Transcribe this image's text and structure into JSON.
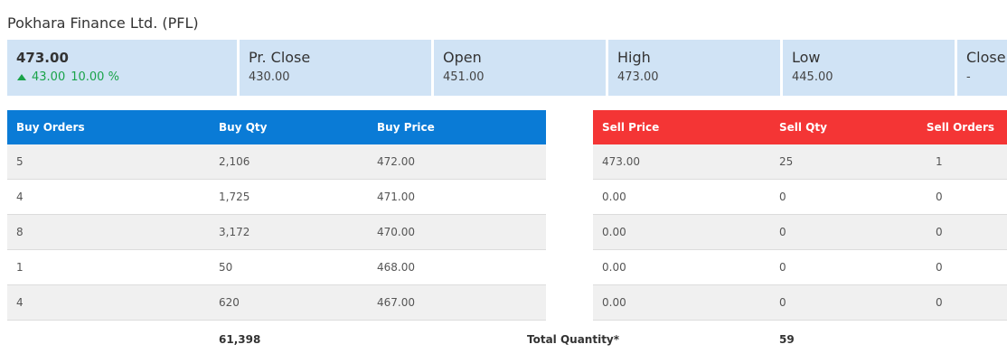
{
  "title": "Pokhara Finance Ltd. (PFL)",
  "stats": {
    "ltp": "473.00",
    "change": "43.00",
    "change_pct": "10.00 %",
    "items": [
      {
        "label": "Pr. Close",
        "value": "430.00"
      },
      {
        "label": "Open",
        "value": "451.00"
      },
      {
        "label": "High",
        "value": "473.00"
      },
      {
        "label": "Low",
        "value": "445.00"
      },
      {
        "label": "Close",
        "value": "-"
      }
    ]
  },
  "colors": {
    "buy_header": "#0a7bd6",
    "sell_header": "#f43535",
    "up": "#1aa34a",
    "stat_bg": "#d0e3f5"
  },
  "buy": {
    "headers": [
      "Buy Orders",
      "Buy Qty",
      "Buy Price"
    ],
    "rows": [
      [
        "5",
        "2,106",
        "472.00"
      ],
      [
        "4",
        "1,725",
        "471.00"
      ],
      [
        "8",
        "3,172",
        "470.00"
      ],
      [
        "1",
        "50",
        "468.00"
      ],
      [
        "4",
        "620",
        "467.00"
      ]
    ]
  },
  "sell": {
    "headers": [
      "Sell Price",
      "Sell Qty",
      "Sell Orders"
    ],
    "rows": [
      [
        "473.00",
        "25",
        "1"
      ],
      [
        "0.00",
        "0",
        "0"
      ],
      [
        "0.00",
        "0",
        "0"
      ],
      [
        "0.00",
        "0",
        "0"
      ],
      [
        "0.00",
        "0",
        "0"
      ]
    ]
  },
  "totals": {
    "buy_qty": "61,398",
    "label": "Total Quantity*",
    "sell_qty": "59"
  }
}
